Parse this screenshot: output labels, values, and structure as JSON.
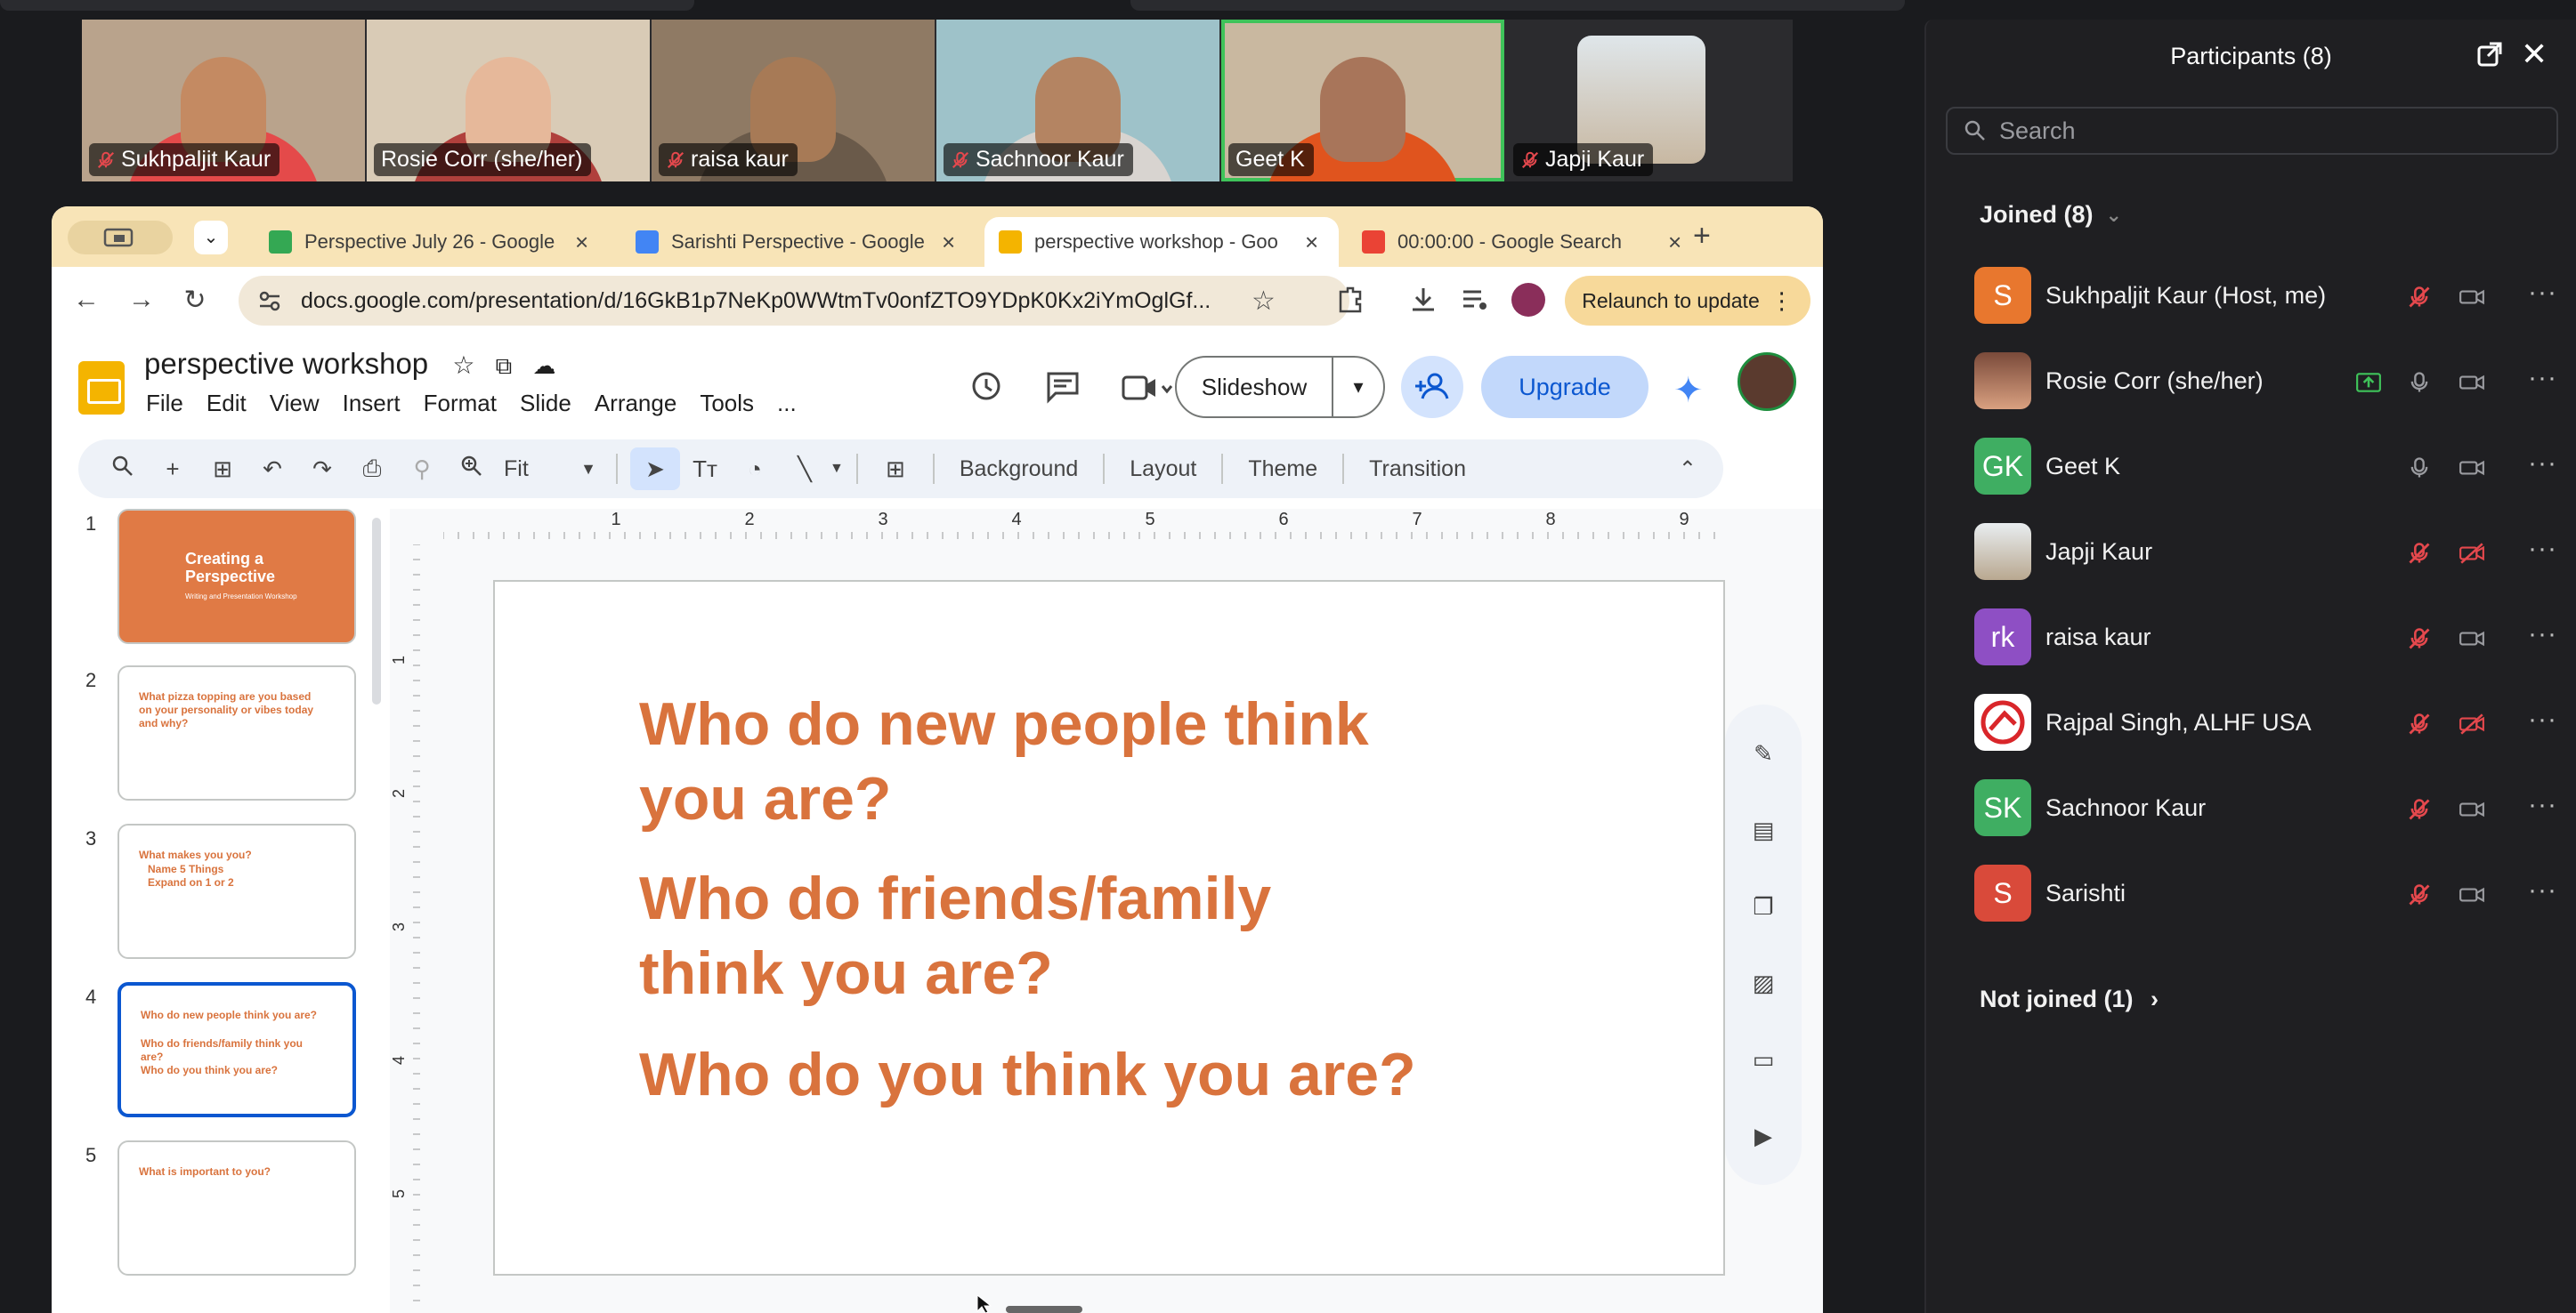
{
  "meeting": {
    "video_tiles": [
      {
        "name": "Sukhpaljit Kaur",
        "muted": true,
        "bg": "#b9a38c",
        "skin": "#c48a62",
        "shirt": "#e44a4a"
      },
      {
        "name": "Rosie Corr (she/her)",
        "muted": false,
        "bg": "#d9cbb6",
        "skin": "#e6b89a",
        "shirt": "#b0403c"
      },
      {
        "name": "raisa kaur",
        "muted": true,
        "bg": "#8f7a64",
        "skin": "#a77a56",
        "shirt": "#6a5a4a"
      },
      {
        "name": "Sachnoor Kaur",
        "muted": true,
        "bg": "#9ec2c9",
        "skin": "#b48462",
        "shirt": "#d8d4d0"
      },
      {
        "name": "Geet K",
        "muted": false,
        "active": true,
        "bg": "#c9b8a0",
        "skin": "#a8755a",
        "shirt": "#e0541e"
      },
      {
        "name": "Japji Kaur",
        "muted": true,
        "bg": "#2b2b2e",
        "skin": "#dfe6ea",
        "shirt": "#b0a090"
      }
    ]
  },
  "browser": {
    "tabs": [
      {
        "title": "Perspective July 26 - Google",
        "icon_color": "#34a853"
      },
      {
        "title": "Sarishti Perspective - Google",
        "icon_color": "#4285f4"
      },
      {
        "title": "perspective workshop - Goo",
        "icon_color": "#f4b400",
        "active": true
      },
      {
        "title": "00:00:00 - Google Search",
        "icon_color": "#ea4335"
      }
    ],
    "url": "docs.google.com/presentation/d/16GkB1p7NeKp0WWtmTv0onfZTO9YDpK0Kx2iYmOglGf...",
    "relaunch_label": "Relaunch to update"
  },
  "slides_app": {
    "title": "perspective workshop",
    "menus": [
      "File",
      "Edit",
      "View",
      "Insert",
      "Format",
      "Slide",
      "Arrange",
      "Tools",
      "..."
    ],
    "slideshow_label": "Slideshow",
    "upgrade_label": "Upgrade",
    "toolbar": {
      "zoom": "Fit",
      "background": "Background",
      "layout": "Layout",
      "theme": "Theme",
      "transition": "Transition"
    },
    "ruler_h": [
      "1",
      "2",
      "3",
      "4",
      "5",
      "6",
      "7",
      "8",
      "9"
    ],
    "ruler_v": [
      "1",
      "2",
      "3",
      "4",
      "5"
    ],
    "thumbnails": [
      {
        "num": "1",
        "title": "Creating a Perspective",
        "subtitle": "Writing and Presentation Workshop"
      },
      {
        "num": "2",
        "title": "What pizza topping are you based on your personality or vibes today and why?"
      },
      {
        "num": "3",
        "title": "What makes you you?",
        "lines": [
          "Name 5 Things",
          "Expand on 1 or 2"
        ]
      },
      {
        "num": "4",
        "title": "Who do new people think you are?",
        "lines": [
          "Who do friends/family think you are?",
          "Who do you think you are?"
        ]
      },
      {
        "num": "5",
        "title": "What is important to you?"
      }
    ],
    "slide": {
      "q1": "Who do new people think you are?",
      "q2": "Who do friends/family think you are?",
      "q3": "Who do you think you are?"
    }
  },
  "participants": {
    "title": "Participants (8)",
    "search_placeholder": "Search",
    "joined_label": "Joined (8)",
    "not_joined_label": "Not joined (1)",
    "list": [
      {
        "initials": "S",
        "name": "Sukhpaljit Kaur (Host, me)",
        "color": "#e8772e",
        "mic": "muted",
        "video": "off-gray"
      },
      {
        "initials": "",
        "name": "Rosie Corr (she/her)",
        "color": "#b86a4e",
        "mic": "on",
        "video": "off-gray",
        "sharing": true
      },
      {
        "initials": "GK",
        "name": "Geet K",
        "color": "#3fae62",
        "mic": "on",
        "video": "off-gray"
      },
      {
        "initials": "",
        "name": "Japji Kaur",
        "color": "#cfd8dc",
        "mic": "muted",
        "video": "muted"
      },
      {
        "initials": "rk",
        "name": "raisa kaur",
        "color": "#8e4fc4",
        "mic": "muted",
        "video": "off-gray"
      },
      {
        "initials": "",
        "name": "Rajpal Singh, ALHF USA",
        "color": "#ffffff",
        "mic": "muted",
        "video": "muted"
      },
      {
        "initials": "SK",
        "name": "Sachnoor Kaur",
        "color": "#3fae62",
        "mic": "muted",
        "video": "off-gray"
      },
      {
        "initials": "S",
        "name": "Sarishti",
        "color": "#d94a3a",
        "mic": "muted",
        "video": "off-gray"
      }
    ]
  },
  "colors": {
    "slide_text": "#d9733d",
    "mute_red": "#e5484d",
    "active_green": "#3fc35a"
  }
}
